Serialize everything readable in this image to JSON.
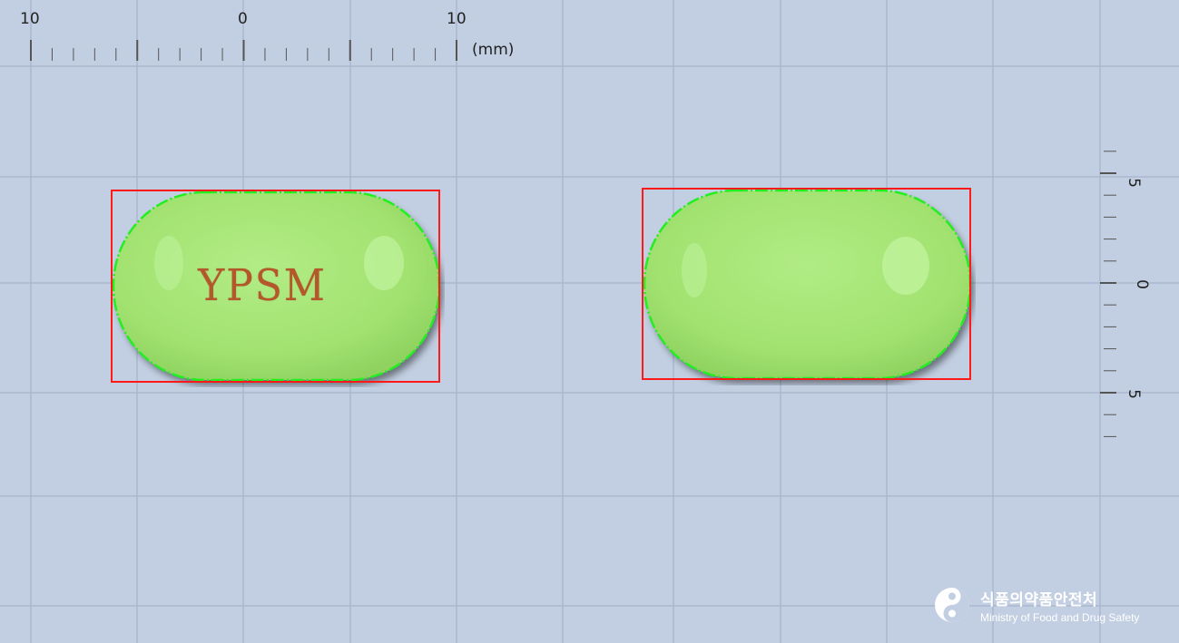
{
  "ruler_top": {
    "labels": [
      "10",
      "0",
      "10"
    ],
    "unit": "(mm)"
  },
  "ruler_right": {
    "labels": [
      "5",
      "0",
      "5"
    ]
  },
  "pills": [
    {
      "imprint": "YPSM",
      "color": "#a8e67a"
    },
    {
      "imprint": "",
      "color": "#a8e67a"
    }
  ],
  "colors": {
    "background": "#c2cfe2",
    "bounding_box": "#ff1a1a",
    "contour": "#22ee22"
  },
  "logo": {
    "name_ko": "식품의약품안전처",
    "name_en": "Ministry of Food and Drug Safety"
  }
}
